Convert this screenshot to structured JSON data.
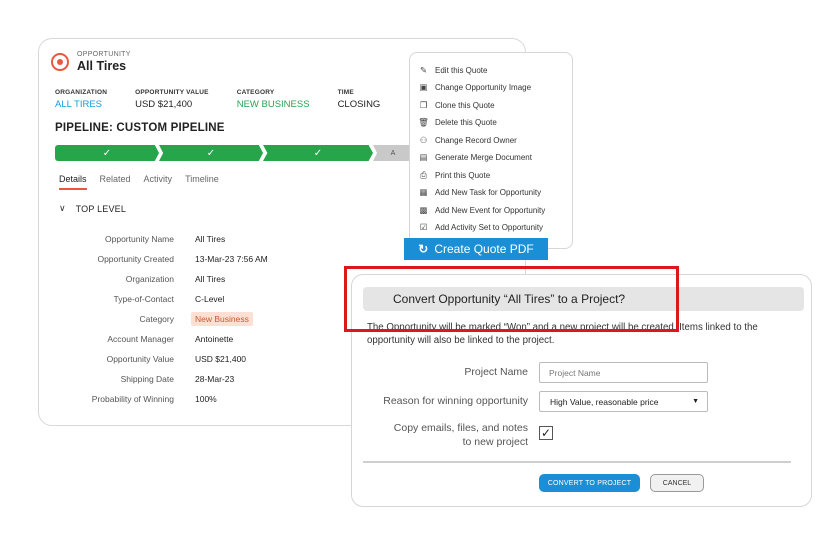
{
  "opportunity": {
    "type_label": "OPPORTUNITY",
    "title": "All Tires",
    "summary": [
      {
        "label": "ORGANIZATION",
        "value": "ALL TIRES"
      },
      {
        "label": "OPPORTUNITY VALUE",
        "value": "USD $21,400"
      },
      {
        "label": "CATEGORY",
        "value": "NEW BUSINESS"
      },
      {
        "label": "TIME",
        "value": "CLOSING"
      }
    ],
    "pipeline_title": "PIPELINE: CUSTOM PIPELINE",
    "pipeline_stages": [
      "✓",
      "✓",
      "✓",
      "A"
    ],
    "tabs": [
      "Details",
      "Related",
      "Activity",
      "Timeline"
    ],
    "section_label": "TOP LEVEL",
    "fields": [
      {
        "label": "Opportunity Name",
        "value": "All Tires"
      },
      {
        "label": "Opportunity Created",
        "value": "13-Mar-23 7:56 AM"
      },
      {
        "label": "Organization",
        "value": "All Tires"
      },
      {
        "label": "Type-of-Contact",
        "value": "C-Level"
      },
      {
        "label": "Category",
        "value": "New Business"
      },
      {
        "label": "Account Manager",
        "value": "Antoinette"
      },
      {
        "label": "Opportunity Value",
        "value": "USD $21,400"
      },
      {
        "label": "Shipping Date",
        "value": "28-Mar-23"
      },
      {
        "label": "Probability of Winning",
        "value": "100%"
      }
    ]
  },
  "menu": {
    "items": [
      {
        "label": "Edit this Quote",
        "icon": "✎"
      },
      {
        "label": "Change Opportunity Image",
        "icon": "▣"
      },
      {
        "label": "Clone this Quote",
        "icon": "❐"
      },
      {
        "label": "Delete this Quote",
        "icon": "🗑"
      },
      {
        "label": "Change Record Owner",
        "icon": "⚇"
      },
      {
        "label": "Generate Merge Document",
        "icon": "▤"
      },
      {
        "label": "Print this Quote",
        "icon": "⎙"
      },
      {
        "label": "Add New Task for Opportunity",
        "icon": "▦"
      },
      {
        "label": "Add New Event for Opportunity",
        "icon": "▩"
      },
      {
        "label": "Add Activity Set to Opportunity",
        "icon": "☑"
      }
    ],
    "create_pdf_label": "Create Quote PDF",
    "create_pdf_icon": "↻"
  },
  "dialog": {
    "title": "Convert Opportunity “All Tires” to a Project?",
    "description": "The Opportunity will be marked “Won” and a new project will be created. Items linked to the opportunity will also be linked to the project.",
    "project_name_label": "Project Name",
    "project_name_placeholder": "Project Name",
    "reason_label": "Reason for winning opportunity",
    "reason_value": "High Value, reasonable price",
    "copy_label_line1": "Copy emails, files, and notes",
    "copy_label_line2": "to new project",
    "copy_checked": "✓",
    "convert_button": "CONVERT TO PROJECT",
    "cancel_button": "CANCEL"
  },
  "colors": {
    "accent_blue": "#1a8fd6",
    "pipeline_green": "#27a54a",
    "brand_orange": "#e9573f",
    "highlight_red": "#d9191c"
  }
}
